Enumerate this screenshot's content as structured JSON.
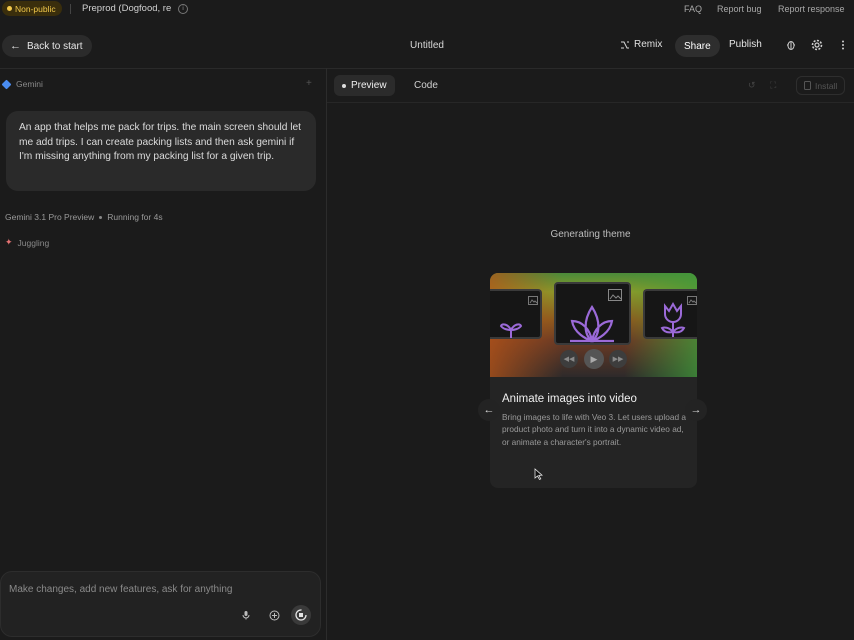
{
  "top_strip": {
    "badge": "Non-public",
    "environment": "Preprod (Dogfood, re",
    "links": [
      "FAQ",
      "Report bug",
      "Report response"
    ]
  },
  "header": {
    "back_label": "Back to start",
    "title": "Untitled",
    "remix_label": "Remix",
    "share_label": "Share",
    "publish_label": "Publish"
  },
  "chat": {
    "model_header": "Gemini",
    "user_message": "An app that helps me pack for trips. the main screen should let me add trips. I can create packing lists and then ask gemini if I'm missing anything from my packing list for a given trip.",
    "model_name": "Gemini 3.1 Pro Preview",
    "run_status": "Running for 4s",
    "activity": "Juggling",
    "composer_placeholder": "Make changes, add new features, ask for anything"
  },
  "preview": {
    "tabs": [
      "Preview",
      "Code"
    ],
    "active_tab": "Preview",
    "install_label": "Install",
    "status": "Generating theme",
    "card": {
      "title": "Animate images into video",
      "description": "Bring images to life with Veo 3. Let users upload a product photo and turn it into a dynamic video ad, or animate a character's portrait."
    }
  },
  "colors": {
    "background": "#1b1b1b",
    "panel": "#2a2a2a",
    "badge_bg": "#3a2e0c",
    "badge_text": "#f2c94c",
    "accent_icon": "#9b6ad8"
  }
}
